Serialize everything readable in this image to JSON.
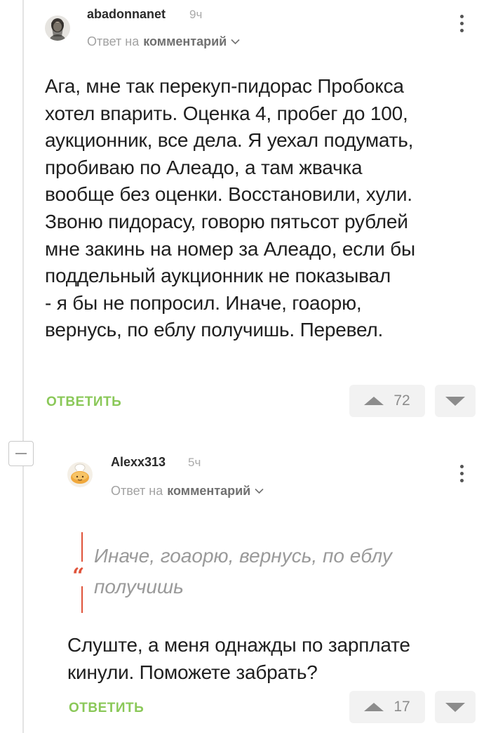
{
  "comment1": {
    "username": "abadonnanet",
    "time": "9ч",
    "reply_prefix": "Ответ на",
    "reply_target": "комментарий",
    "body_lines": [
      "Ага, мне так перекуп-пидорас Пробокса",
      "хотел впарить. Оценка 4, пробег до 100,",
      "аукционник, все дела. Я уехал подумать,",
      "пробиваю по Алеадо, а там жвачка",
      "вообще без оценки. Восстановили, хули.",
      "Звоню пидорасу, говорю пятьсот рублей",
      "мне закинь на номер за Алеадо, если бы",
      "поддельный аукционник не показывал",
      "- я бы не попросил. Иначе, гоаорю,",
      "вернусь, по еблу получишь. Перевел."
    ],
    "reply_label": "ОТВЕТИТЬ",
    "rating": "72"
  },
  "comment2": {
    "username": "Alexx313",
    "time": "5ч",
    "reply_prefix": "Ответ на",
    "reply_target": "комментарий",
    "quote_lines": [
      "Иначе, гоаорю, вернусь, по еблу",
      "получишь"
    ],
    "quote_mark": "“",
    "body_lines": [
      "Слуште, а меня однажды по зарплате",
      "кинули. Поможете забрать?"
    ],
    "reply_label": "ОТВЕТИТЬ",
    "rating": "17"
  },
  "colors": {
    "accent_green": "#8ac858",
    "quote_red": "#e0533a"
  },
  "icons": [
    "chevron-down-icon",
    "more-vert-icon",
    "arrow-up-icon",
    "arrow-down-icon",
    "collapse-icon",
    "avatar-girl",
    "avatar-bread"
  ]
}
